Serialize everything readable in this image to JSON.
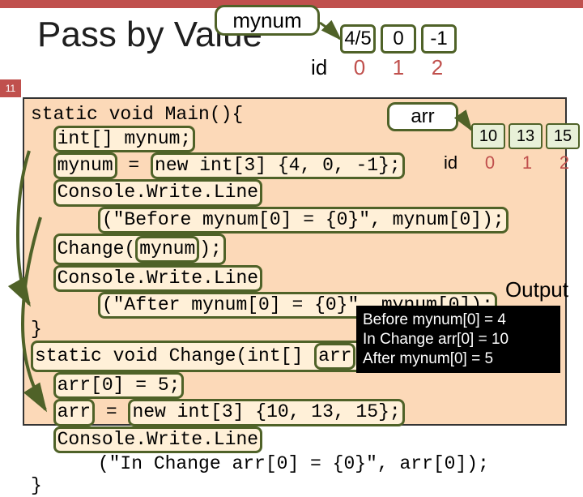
{
  "slide": {
    "number": "11",
    "title": "Pass by Value"
  },
  "mynum": {
    "label": "mynum",
    "cells": [
      "4/5",
      "0",
      "-1"
    ],
    "id_label": "id",
    "indexes": [
      "0",
      "1",
      "2"
    ]
  },
  "arr": {
    "label": "arr",
    "cells": [
      "10",
      "13",
      "15"
    ],
    "id_label": "id",
    "indexes": [
      "0",
      "1",
      "2"
    ]
  },
  "code": {
    "l1a": "static void Main(){",
    "l2a": "  ",
    "l2b": "int[] mynum;",
    "l3a": "  ",
    "l3b": "mynum",
    "l3c": " = ",
    "l3d": "new int[3] {4, 0, -1};",
    "l4a": "  ",
    "l4b": "Console.Write.Line",
    "l5a": "      ",
    "l5b": "(\"Before mynum[0] = {0}\", mynum[0]);",
    "l6a": "  ",
    "l6b": "Change(",
    "l6c": "mynum",
    "l6d": ");",
    "l7a": "  ",
    "l7b": "Console.Write.Line",
    "l8a": "      ",
    "l8b": "(\"After mynum[0] = {0}\", mynum[0]);",
    "l9a": "}",
    "l10a": "static void Change(int[] ",
    "l10b": "arr",
    "l10c": ") {",
    "l11a": "  ",
    "l11b": "arr[0] = 5;",
    "l12a": "  ",
    "l12b": "arr",
    "l12c": " = ",
    "l12d": "new int[3] {10, 13, 15};",
    "l13a": "  ",
    "l13b": "Console.Write.Line",
    "l14a": "      (\"In Change arr[0] = {0}\", arr[0]);",
    "l15a": "}"
  },
  "output": {
    "title": "Output",
    "lines": [
      "Before mynum[0] = 4",
      "In Change arr[0] = 10",
      "After mynum[0] = 5"
    ]
  }
}
